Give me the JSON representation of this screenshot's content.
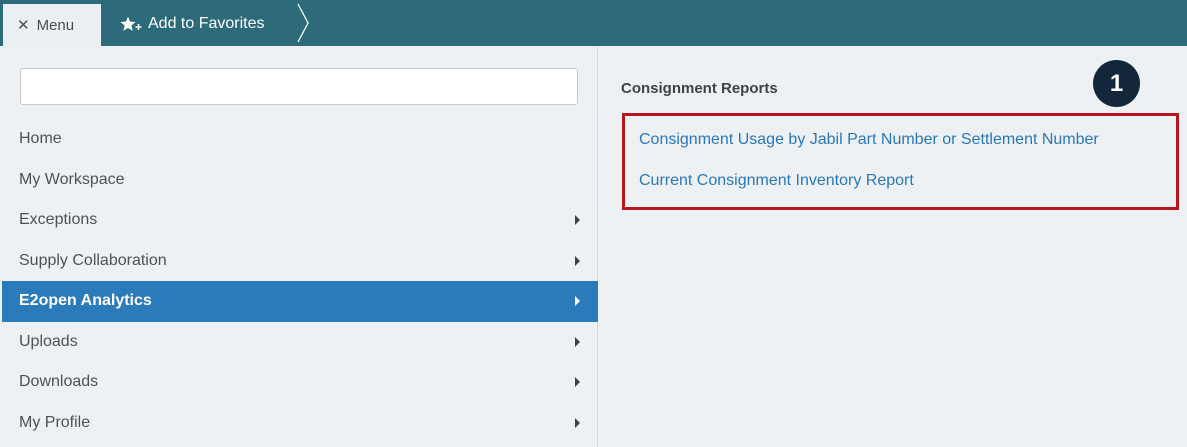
{
  "topbar": {
    "menu_label": "Menu",
    "menu_close_glyph": "✕",
    "favorites_label": "Add to Favorites",
    "favorites_icon": "star-plus-icon",
    "accent_color": "#2e6b7a"
  },
  "sidebar": {
    "search": {
      "value": "",
      "placeholder": ""
    },
    "items": [
      {
        "label": "Home",
        "has_submenu": false,
        "active": false
      },
      {
        "label": "My Workspace",
        "has_submenu": false,
        "active": false
      },
      {
        "label": "Exceptions",
        "has_submenu": true,
        "active": false
      },
      {
        "label": "Supply Collaboration",
        "has_submenu": true,
        "active": false
      },
      {
        "label": "E2open Analytics",
        "has_submenu": true,
        "active": true
      },
      {
        "label": "Uploads",
        "has_submenu": true,
        "active": false
      },
      {
        "label": "Downloads",
        "has_submenu": true,
        "active": false
      },
      {
        "label": "My Profile",
        "has_submenu": true,
        "active": false
      }
    ],
    "active_color": "#2b7bbb"
  },
  "content": {
    "section_title": "Consignment Reports",
    "links": [
      {
        "label": "Consignment Usage by Jabil Part Number or Settlement Number"
      },
      {
        "label": "Current Consignment Inventory Report"
      }
    ],
    "callout_number": "1",
    "highlight_color": "#b8151f",
    "link_color": "#2a78b8"
  }
}
